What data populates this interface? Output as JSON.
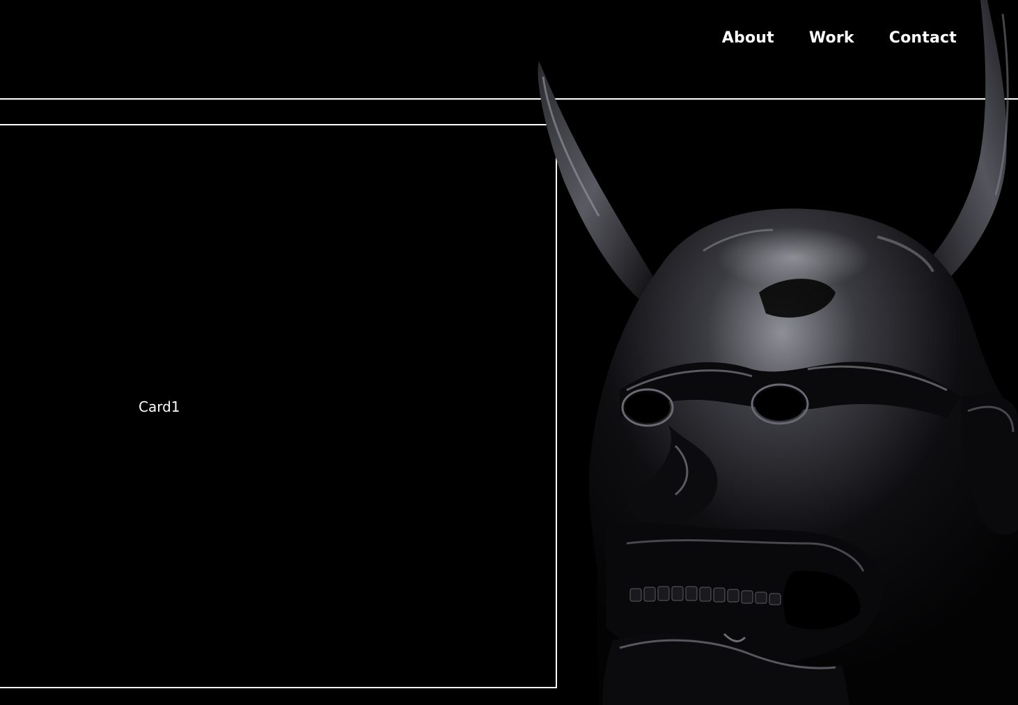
{
  "nav": {
    "items": [
      {
        "label": "About"
      },
      {
        "label": "Work"
      },
      {
        "label": "Contact"
      }
    ]
  },
  "card": {
    "label": "Card1"
  },
  "artwork": {
    "icon": "oni-mask-icon"
  },
  "colors": {
    "background": "#000000",
    "foreground": "#ffffff",
    "mask_base": "#0a0a0c",
    "mask_highlight": "#8a8a92"
  }
}
